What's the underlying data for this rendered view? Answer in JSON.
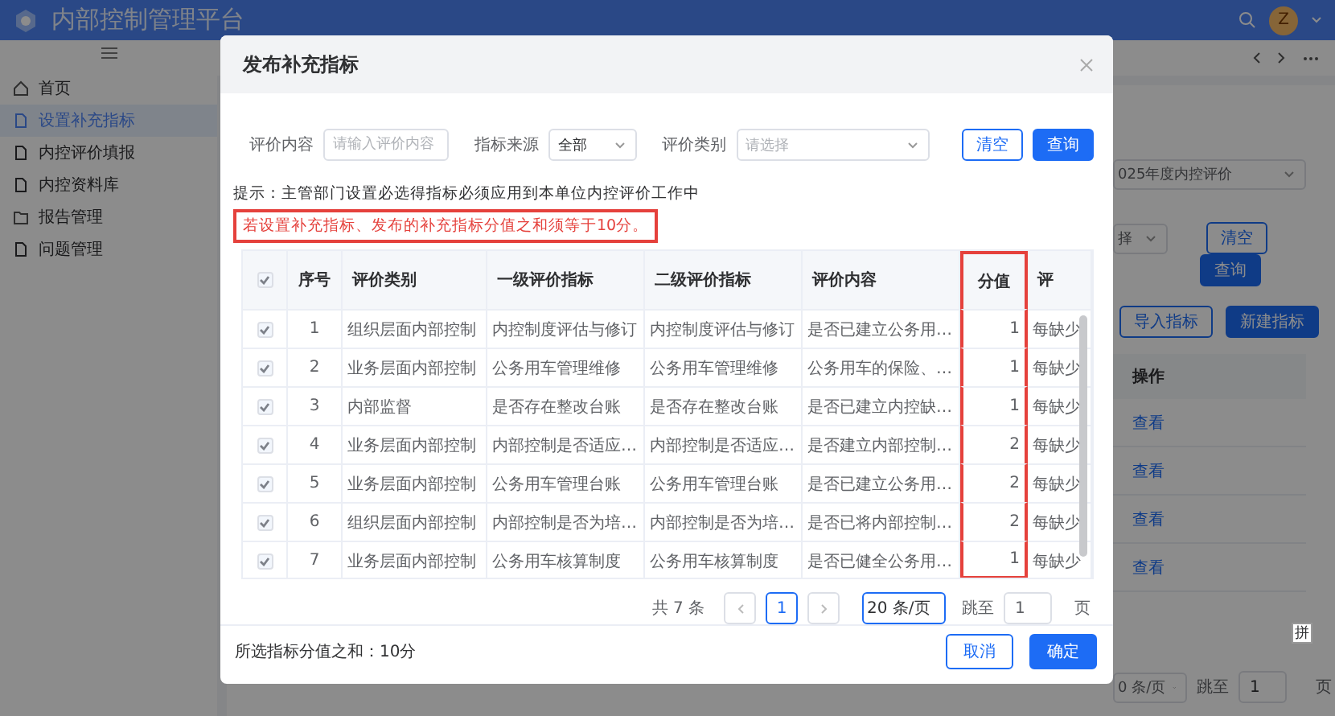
{
  "header": {
    "title": "内部控制管理平台",
    "avatar": "Z"
  },
  "sidebar": {
    "items": [
      {
        "label": "首页",
        "selected": false
      },
      {
        "label": "设置补充指标",
        "selected": true
      },
      {
        "label": "内控评价填报",
        "selected": false
      },
      {
        "label": "内控资料库",
        "selected": false
      },
      {
        "label": "报告管理",
        "selected": false
      },
      {
        "label": "问题管理",
        "selected": false
      }
    ]
  },
  "background": {
    "plan_select": "025年度内控评价",
    "type_select": "择",
    "buttons": [
      {
        "label": "清空",
        "kind": "outline"
      },
      {
        "label": "查询",
        "kind": "primary"
      },
      {
        "label": "导入指标",
        "kind": "outline"
      },
      {
        "label": "新建指标",
        "kind": "primary"
      }
    ],
    "table": {
      "column": "操作",
      "rows": [
        {
          "action": "查看"
        },
        {
          "action": "查看"
        },
        {
          "action": "查看"
        },
        {
          "action": "查看"
        }
      ]
    },
    "pagination": {
      "page_size": "0 条/页",
      "jump_label": "跳至",
      "jump_value": "1",
      "jump_suffix": "页"
    }
  },
  "ime": {
    "label": "拼"
  },
  "modal": {
    "title": "发布补充指标",
    "filters": [
      {
        "label": "评价内容",
        "kind": "input",
        "placeholder": "请输入评价内容"
      },
      {
        "label": "指标来源",
        "kind": "select",
        "value": "全部"
      },
      {
        "label": "评价类别",
        "kind": "select",
        "placeholder": "请选择"
      }
    ],
    "buttons": [
      {
        "label": "清空",
        "kind": "outline"
      },
      {
        "label": "查询",
        "kind": "primary"
      }
    ],
    "hint": "提示：主管部门设置必选得指标必须应用到本单位内控评价工作中",
    "warning": "若设置补充指标、发布的补充指标分值之和须等于10分。",
    "table": {
      "header_checked": true,
      "columns": [
        {
          "label": "序号",
          "highlighted": false
        },
        {
          "label": "评价类别",
          "highlighted": false
        },
        {
          "label": "一级评价指标",
          "highlighted": false
        },
        {
          "label": "二级评价指标",
          "highlighted": false
        },
        {
          "label": "评价内容",
          "highlighted": false
        },
        {
          "label": "分值",
          "highlighted": true
        },
        {
          "label": "评",
          "highlighted": false
        }
      ],
      "rows": [
        {
          "checked": true,
          "cells": [
            "1",
            "组织层面内部控制",
            "内控制度评估与修订",
            "内控制度评估与修订",
            "是否已建立公务用…",
            "1",
            "每缺少"
          ]
        },
        {
          "checked": true,
          "cells": [
            "2",
            "业务层面内部控制",
            "公务用车管理维修",
            "公务用车管理维修",
            "公务用车的保险、…",
            "1",
            "每缺少"
          ]
        },
        {
          "checked": true,
          "cells": [
            "3",
            "内部监督",
            "是否存在整改台账",
            "是否存在整改台账",
            "是否已建立内控缺…",
            "1",
            "每缺少"
          ]
        },
        {
          "checked": true,
          "cells": [
            "4",
            "业务层面内部控制",
            "内部控制是否适应…",
            "内部控制是否适应…",
            "是否建立内部控制…",
            "2",
            "每缺少"
          ]
        },
        {
          "checked": true,
          "cells": [
            "5",
            "业务层面内部控制",
            "公务用车管理台账",
            "公务用车管理台账",
            "是否已建立公务用…",
            "2",
            "每缺少"
          ]
        },
        {
          "checked": true,
          "cells": [
            "6",
            "组织层面内部控制",
            "内部控制是否为培…",
            "内部控制是否为培…",
            "是否已将内部控制…",
            "2",
            "每缺少"
          ]
        },
        {
          "checked": true,
          "cells": [
            "7",
            "业务层面内部控制",
            "公务用车核算制度",
            "公务用车核算制度",
            "是否已健全公务用…",
            "1",
            "每缺少"
          ]
        }
      ]
    },
    "pagination": {
      "total": "共 7 条",
      "pages": [
        {
          "label": "1",
          "selected": true
        }
      ],
      "page_size": "20 条/页",
      "jump_label": "跳至",
      "jump_value": "1",
      "jump_suffix": "页"
    },
    "footer": {
      "sum": "所选指标分值之和：10分",
      "buttons": [
        {
          "label": "取消",
          "kind": "outline"
        },
        {
          "label": "确定",
          "kind": "primary"
        }
      ]
    }
  }
}
